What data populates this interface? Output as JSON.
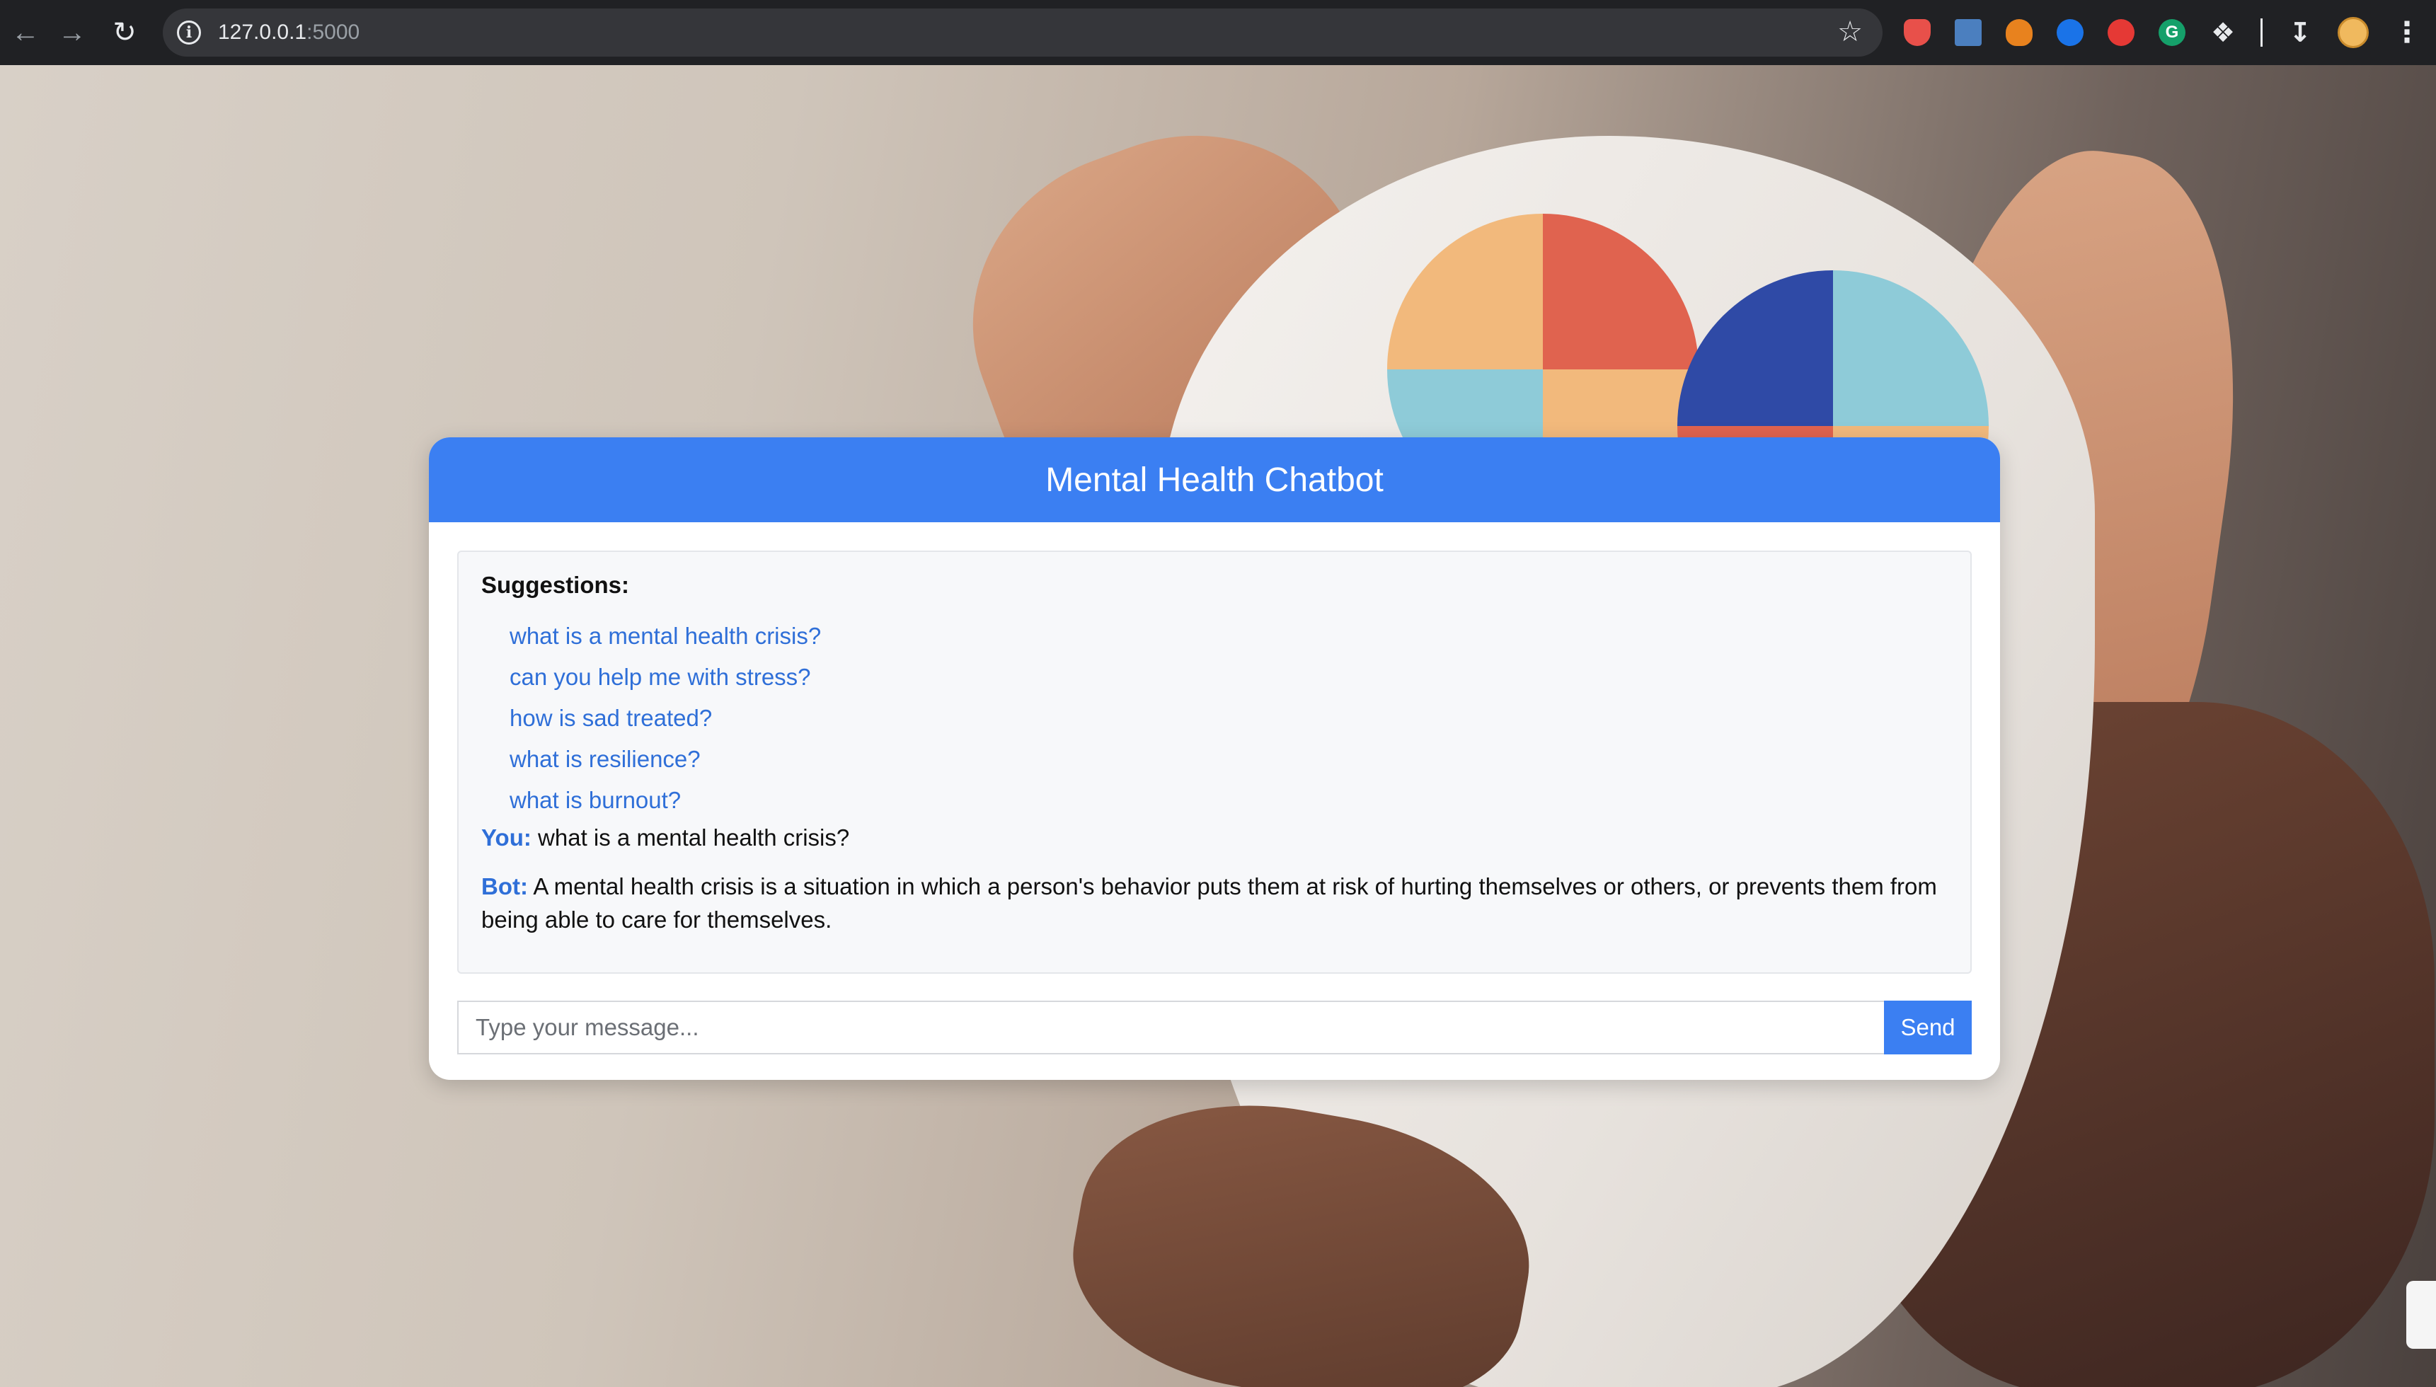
{
  "browser": {
    "url_host": "127.0.0.1",
    "url_port": ":5000",
    "nav": {
      "back_icon": "arrow-left-icon",
      "forward_icon": "arrow-right-icon",
      "reload_icon": "reload-icon"
    }
  },
  "chat": {
    "title": "Mental Health Chatbot",
    "suggestions_label": "Suggestions:",
    "suggestions": [
      "what is a mental health crisis?",
      "can you help me with stress?",
      "how is sad treated?",
      "what is resilience?",
      "what is burnout?"
    ],
    "messages": [
      {
        "speaker": "You:",
        "text": " what is a mental health crisis?"
      },
      {
        "speaker": "Bot:",
        "text": " A mental health crisis is a situation in which a person's behavior puts them at risk of hurting themselves or others, or prevents them from being able to care for themselves."
      }
    ],
    "input_placeholder": "Type your message...",
    "input_value": "",
    "send_label": "Send"
  },
  "colors": {
    "accent": "#3b7ff2",
    "link": "#2f6fd8",
    "chrome_bg": "#202124",
    "omnibox_bg": "#35363a"
  }
}
